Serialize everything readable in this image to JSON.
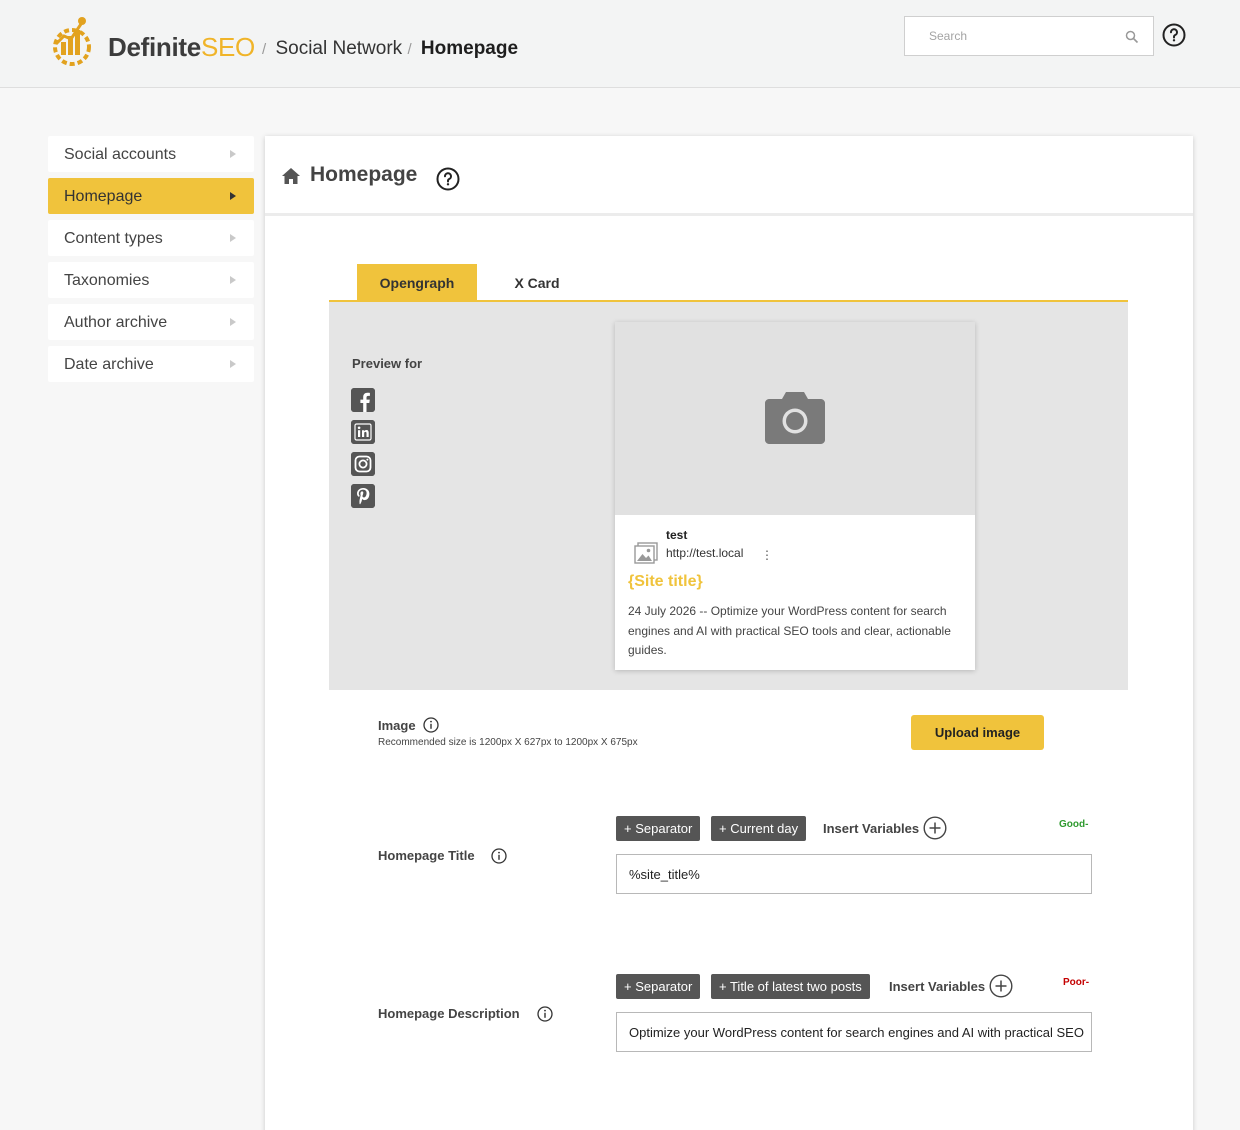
{
  "header": {
    "brand_main": "Definite",
    "brand_accent": "SEO",
    "breadcrumb": {
      "sep": "/",
      "section": "Social Network",
      "current": "Homepage"
    },
    "search_placeholder": "Search",
    "accent_color": "#f0c33c"
  },
  "sidebar": {
    "items": [
      {
        "label": "Social accounts",
        "active": false
      },
      {
        "label": "Homepage",
        "active": true
      },
      {
        "label": "Content types",
        "active": false
      },
      {
        "label": "Taxonomies",
        "active": false
      },
      {
        "label": "Author archive",
        "active": false
      },
      {
        "label": "Date archive",
        "active": false
      }
    ]
  },
  "panel": {
    "title": "Homepage",
    "tabs": [
      {
        "label": "Opengraph",
        "active": true
      },
      {
        "label": "X Card",
        "active": false
      }
    ],
    "preview": {
      "preview_for_label": "Preview for",
      "networks": [
        "facebook-icon",
        "linkedin-icon",
        "instagram-icon",
        "pinterest-icon"
      ],
      "card": {
        "site_name": "test",
        "url": "http://test.local",
        "menu_glyph": "⋮",
        "title": "{Site title}",
        "description": "24 July 2026 -- Optimize your WordPress content for search engines and AI with practical SEO tools and clear, actionable guides."
      }
    },
    "image": {
      "label": "Image",
      "hint": "Recommended size is 1200px X 627px to 1200px X 675px",
      "upload_label": "Upload image"
    },
    "title_field": {
      "label": "Homepage Title",
      "chips": [
        "+ Separator",
        "+ Current day"
      ],
      "insert_label": "Insert Variables",
      "score": "Good-",
      "score_color": "#2e9a2e",
      "value": "%site_title%"
    },
    "description_field": {
      "label": "Homepage Description",
      "chips": [
        "+ Separator",
        "+ Title of latest two posts"
      ],
      "insert_label": "Insert Variables",
      "score": "Poor-",
      "score_color": "#c40000",
      "value": "Optimize your WordPress content for search engines and AI with practical SEO"
    }
  }
}
